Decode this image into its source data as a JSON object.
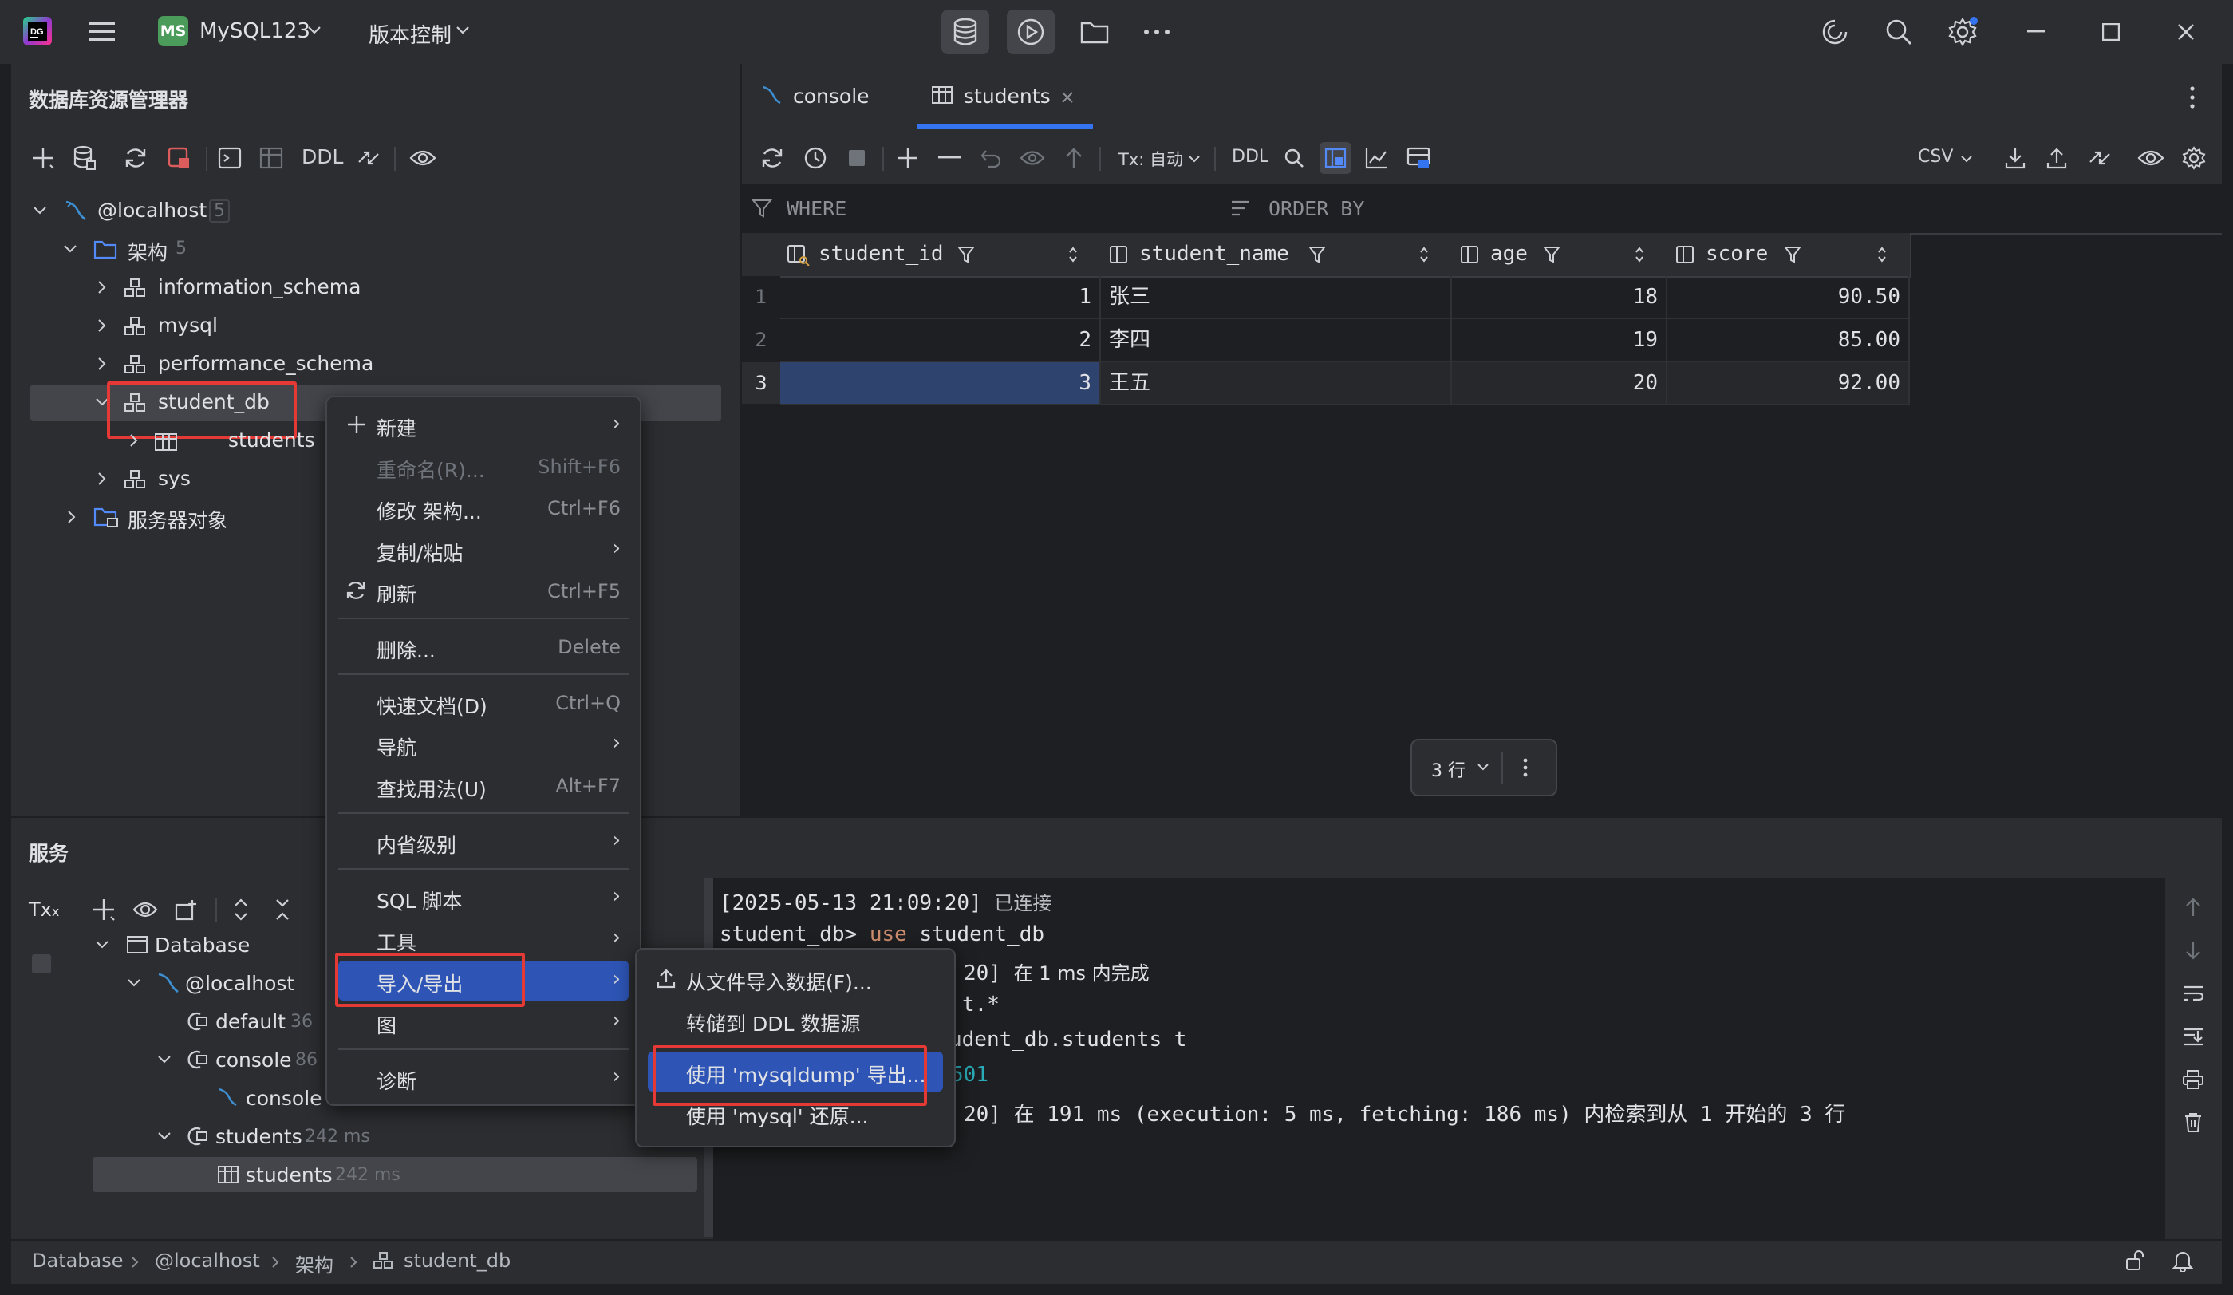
{
  "titlebar": {
    "project_badge": "MS",
    "project_name": "MySQL123",
    "vcs_label": "版本控制"
  },
  "db_explorer": {
    "title": "数据库资源管理器",
    "toolbar_ddl": "DDL",
    "tree": {
      "host": "@localhost",
      "host_count": "5",
      "schemas_label": "架构",
      "schemas_count": "5",
      "items": [
        "information_schema",
        "mysql",
        "performance_schema",
        "student_db",
        "students",
        "sys"
      ],
      "server_objects": "服务器对象"
    }
  },
  "editor_tabs": {
    "console": "console",
    "students": "students"
  },
  "grid_toolbar": {
    "tx_label": "Tx: 自动",
    "ddl_label": "DDL",
    "csv_label": "CSV"
  },
  "filter": {
    "where": "WHERE",
    "order_by": "ORDER BY"
  },
  "table": {
    "columns": [
      "student_id",
      "student_name",
      "age",
      "score"
    ],
    "rows": [
      {
        "num": "1",
        "student_id": "1",
        "student_name": "张三",
        "age": "18",
        "score": "90.50"
      },
      {
        "num": "2",
        "student_id": "2",
        "student_name": "李四",
        "age": "19",
        "score": "85.00"
      },
      {
        "num": "3",
        "student_id": "3",
        "student_name": "王五",
        "age": "20",
        "score": "92.00"
      }
    ],
    "row_count": "3 行"
  },
  "context_menu": {
    "items": [
      {
        "label": "新建"
      },
      {
        "label": "重命名(R)...",
        "shortcut": "Shift+F6"
      },
      {
        "label": "修改 架构...",
        "shortcut": "Ctrl+F6"
      },
      {
        "label": "复制/粘贴"
      },
      {
        "label": "刷新",
        "shortcut": "Ctrl+F5"
      },
      {
        "label": "删除...",
        "shortcut": "Delete"
      },
      {
        "label": "快速文档(D)",
        "shortcut": "Ctrl+Q"
      },
      {
        "label": "导航"
      },
      {
        "label": "查找用法(U)",
        "shortcut": "Alt+F7"
      },
      {
        "label": "内省级别"
      },
      {
        "label": "SQL 脚本"
      },
      {
        "label": "工具"
      },
      {
        "label": "导入/导出"
      },
      {
        "label": "图"
      },
      {
        "label": "诊断"
      }
    ]
  },
  "submenu": {
    "items": [
      {
        "label": "从文件导入数据(F)..."
      },
      {
        "label": "转储到 DDL 数据源"
      },
      {
        "label": "使用 'mysqldump' 导出..."
      },
      {
        "label": "使用 'mysql' 还原..."
      }
    ]
  },
  "services": {
    "title": "服务",
    "tx": "Tx",
    "tree": {
      "database": "Database",
      "localhost": "@localhost",
      "default": "default",
      "default_time": "36",
      "console": "console",
      "console_time": "86",
      "console_child": "console",
      "students": "students",
      "students_time": "242 ms",
      "students_child": "students",
      "students_child_time": "242 ms"
    }
  },
  "console_log": {
    "l1_ts": "[2025-05-13 21:09:20]",
    "l1_msg": "已连接",
    "l2_prompt": "student_db>",
    "l2_kw": "use",
    "l2_rest": "student_db",
    "l3_ts": "20]",
    "l3_msg": "在 1 ms 内完成",
    "l4": "t.*",
    "l5": "udent_db.students t",
    "l6": "501",
    "l7_ts": "20]",
    "l7_msg": "在 191 ms (execution: 5 ms, fetching: 186 ms) 内检索到从 1 开始的 3 行"
  },
  "statusbar": {
    "crumbs": [
      "Database",
      "@localhost",
      "架构",
      "student_db"
    ]
  },
  "colors": {
    "accent_selected": "#2e436e",
    "menu_selected": "#2e55b5",
    "highlight_red": "#e53935",
    "keyword_orange": "#cf8e6d",
    "teal": "#2aacb8"
  }
}
